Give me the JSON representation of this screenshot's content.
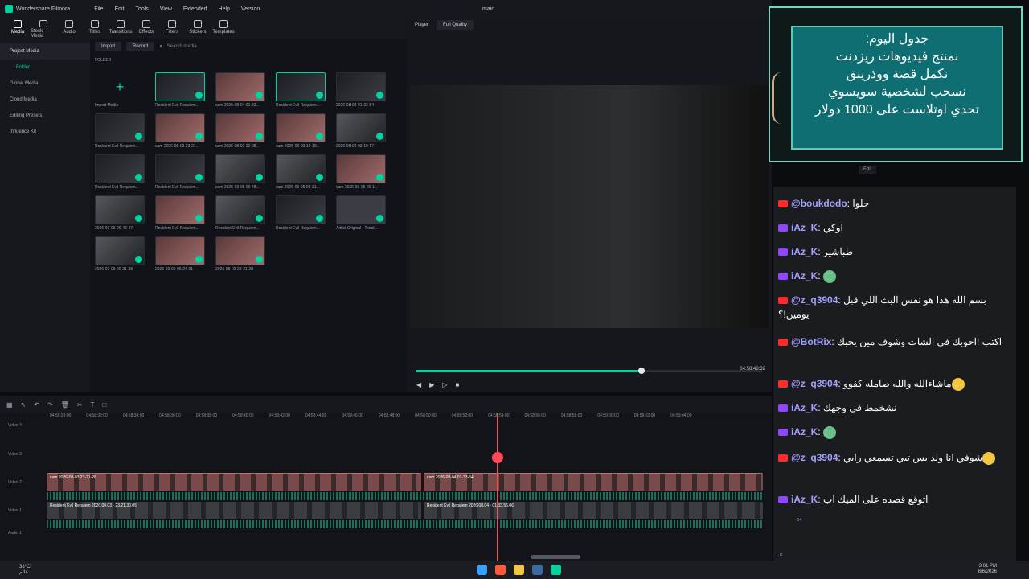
{
  "app": {
    "title": "Wondershare Filmora",
    "project": "main",
    "menu": [
      "File",
      "Edit",
      "Tools",
      "View",
      "Extended",
      "Help",
      "Version"
    ]
  },
  "toolbar": [
    "Media",
    "Stock Media",
    "Audio",
    "Titles",
    "Transitions",
    "Effects",
    "Filters",
    "Stickers",
    "Templates"
  ],
  "sidebar": {
    "items": [
      "Project Media",
      "Folder",
      "Global Media",
      "Cloud Media",
      "Editing Presets",
      "Influence Kit"
    ]
  },
  "media": {
    "import_label": "Import",
    "record_label": "Record",
    "search_placeholder": "Search media",
    "folder_label": "FOLDER",
    "items": [
      {
        "caption": "Import Media"
      },
      {
        "caption": "Resident Evil Requiem...",
        "dur": "00:10:21"
      },
      {
        "caption": "cam 2026-08-04 01-33...",
        "dur": "00:10:21"
      },
      {
        "caption": "Resident Evil Requiem...",
        "dur": "00:05:51"
      },
      {
        "caption": "2026-08-04 01-33-54",
        "dur": "00:02:20"
      },
      {
        "caption": "Resident Evil Requiem...",
        "dur": "00:22:10"
      },
      {
        "caption": "cam 2026-08-03 23-21...",
        "dur": "00:22:10"
      },
      {
        "caption": "cam 2026-08-03 22-08...",
        "dur": "00:12:53"
      },
      {
        "caption": "cam 2026-08-03 19-10...",
        "dur": "00:10:21"
      },
      {
        "caption": "2026-08-04 03-19-17",
        "dur": "00:10:21"
      },
      {
        "caption": "Resident Evil Requiem...",
        "dur": "00:17:35"
      },
      {
        "caption": "Resident Evil Requiem...",
        "dur": "00:07:55"
      },
      {
        "caption": "cam 2026-03-05 06-48...",
        "dur": "00:11:55"
      },
      {
        "caption": "cam 2026-03-05 06-31...",
        "dur": "00:11:52"
      },
      {
        "caption": "cam 2026-03-05 06-1...",
        "dur": "00:05:48"
      },
      {
        "caption": "2026-03-05 06-48-47",
        "dur": "00:10:11"
      },
      {
        "caption": "Resident Evil Requiem...",
        "dur": "00:11:52"
      },
      {
        "caption": "Resident Evil Requiem...",
        "dur": "00:11:52"
      },
      {
        "caption": "Resident Evil Requiem...",
        "dur": "00:00:40"
      },
      {
        "caption": "Artlist Original - Tonal...",
        "dur": "00:00:01"
      },
      {
        "caption": "2026-03-05 06-31-38",
        "dur": "00:11:52"
      },
      {
        "caption": "2026-03-05 06-24-31",
        "dur": "00:05:49"
      },
      {
        "caption": "2026-08-03 23-21-28",
        "dur": ""
      }
    ]
  },
  "player": {
    "label": "Player",
    "quality": "Full Quality",
    "timecode": "04:58:48:32",
    "progress": 0.65
  },
  "timeline": {
    "ruler": [
      "04:58:28:00",
      "04:58:32:00",
      "04:58:34:00",
      "04:58:36:00",
      "04:58:38:00",
      "04:58:40:00",
      "04:58:42:00",
      "04:58:44:00",
      "04:58:46:00",
      "04:58:48:00",
      "04:58:50:00",
      "04:58:52:00",
      "04:58:54:00",
      "04:58:56:00",
      "04:58:58:00",
      "04:59:00:00",
      "04:59:02:00",
      "04:59:04:00"
    ],
    "tracks": [
      "Video 4",
      "Video 3",
      "Video 2",
      "Video 1",
      "Audio 1"
    ],
    "clips": {
      "v2a": "cam 2026-08-03 23-21-28",
      "v2b": "cam 2026-08-04 01-33-54",
      "v1a": "Resident Evil Requiem 2026.08.03 - 23.21.30.05",
      "v1b": "Resident Evil Requiem 2026.08.04 - 01.33.56.06"
    }
  },
  "overlay": {
    "schedule_lines": [
      "جدول اليوم:",
      "نمنتج فيديوهات ريزدنت",
      "نكمل قصة ووذرينق",
      "نسحب لشخصية سويسوي",
      "تحدي اوتلاست على 1000 دولار"
    ],
    "edit_label": "Edit"
  },
  "chat": [
    {
      "platform": "youtube",
      "user": "@boukdodo",
      "text": "حلوا"
    },
    {
      "platform": "twitch",
      "user": "iAz_K",
      "text": "اوكي"
    },
    {
      "platform": "twitch",
      "user": "iAz_K",
      "text": "طباشير"
    },
    {
      "platform": "twitch",
      "user": "iAz_K",
      "text": "",
      "emote": true
    },
    {
      "platform": "youtube",
      "user": "@z_q3904",
      "text": "بسم الله هذا هو نفس البث اللي قبل يومين!؟"
    },
    {
      "platform": "youtube",
      "user": "@BotRix",
      "text": "اكتب !احوبك في الشات وشوف مين يحبك"
    },
    {
      "platform": "youtube",
      "user": "@z_q3904",
      "text": "ماشاءالله والله صامله كفوو",
      "emote": true
    },
    {
      "platform": "twitch",
      "user": "iAz_K",
      "text": "نشخمط في وجهك"
    },
    {
      "platform": "twitch",
      "user": "iAz_K",
      "text": "",
      "emote": true
    },
    {
      "platform": "youtube",
      "user": "@z_q3904",
      "text": "شوفي انا ولد بس تبي تسمعي رايي",
      "emote": true
    },
    {
      "platform": "twitch",
      "user": "iAz_K",
      "text": "اتوقع قصده على الميك اب"
    }
  ],
  "taskbar": {
    "weather_temp": "38°C",
    "weather_text": "غائم",
    "time": "3:01 PM",
    "date": "8/6/2026"
  },
  "meter": {
    "top": "-54",
    "bottom": "L  R"
  }
}
